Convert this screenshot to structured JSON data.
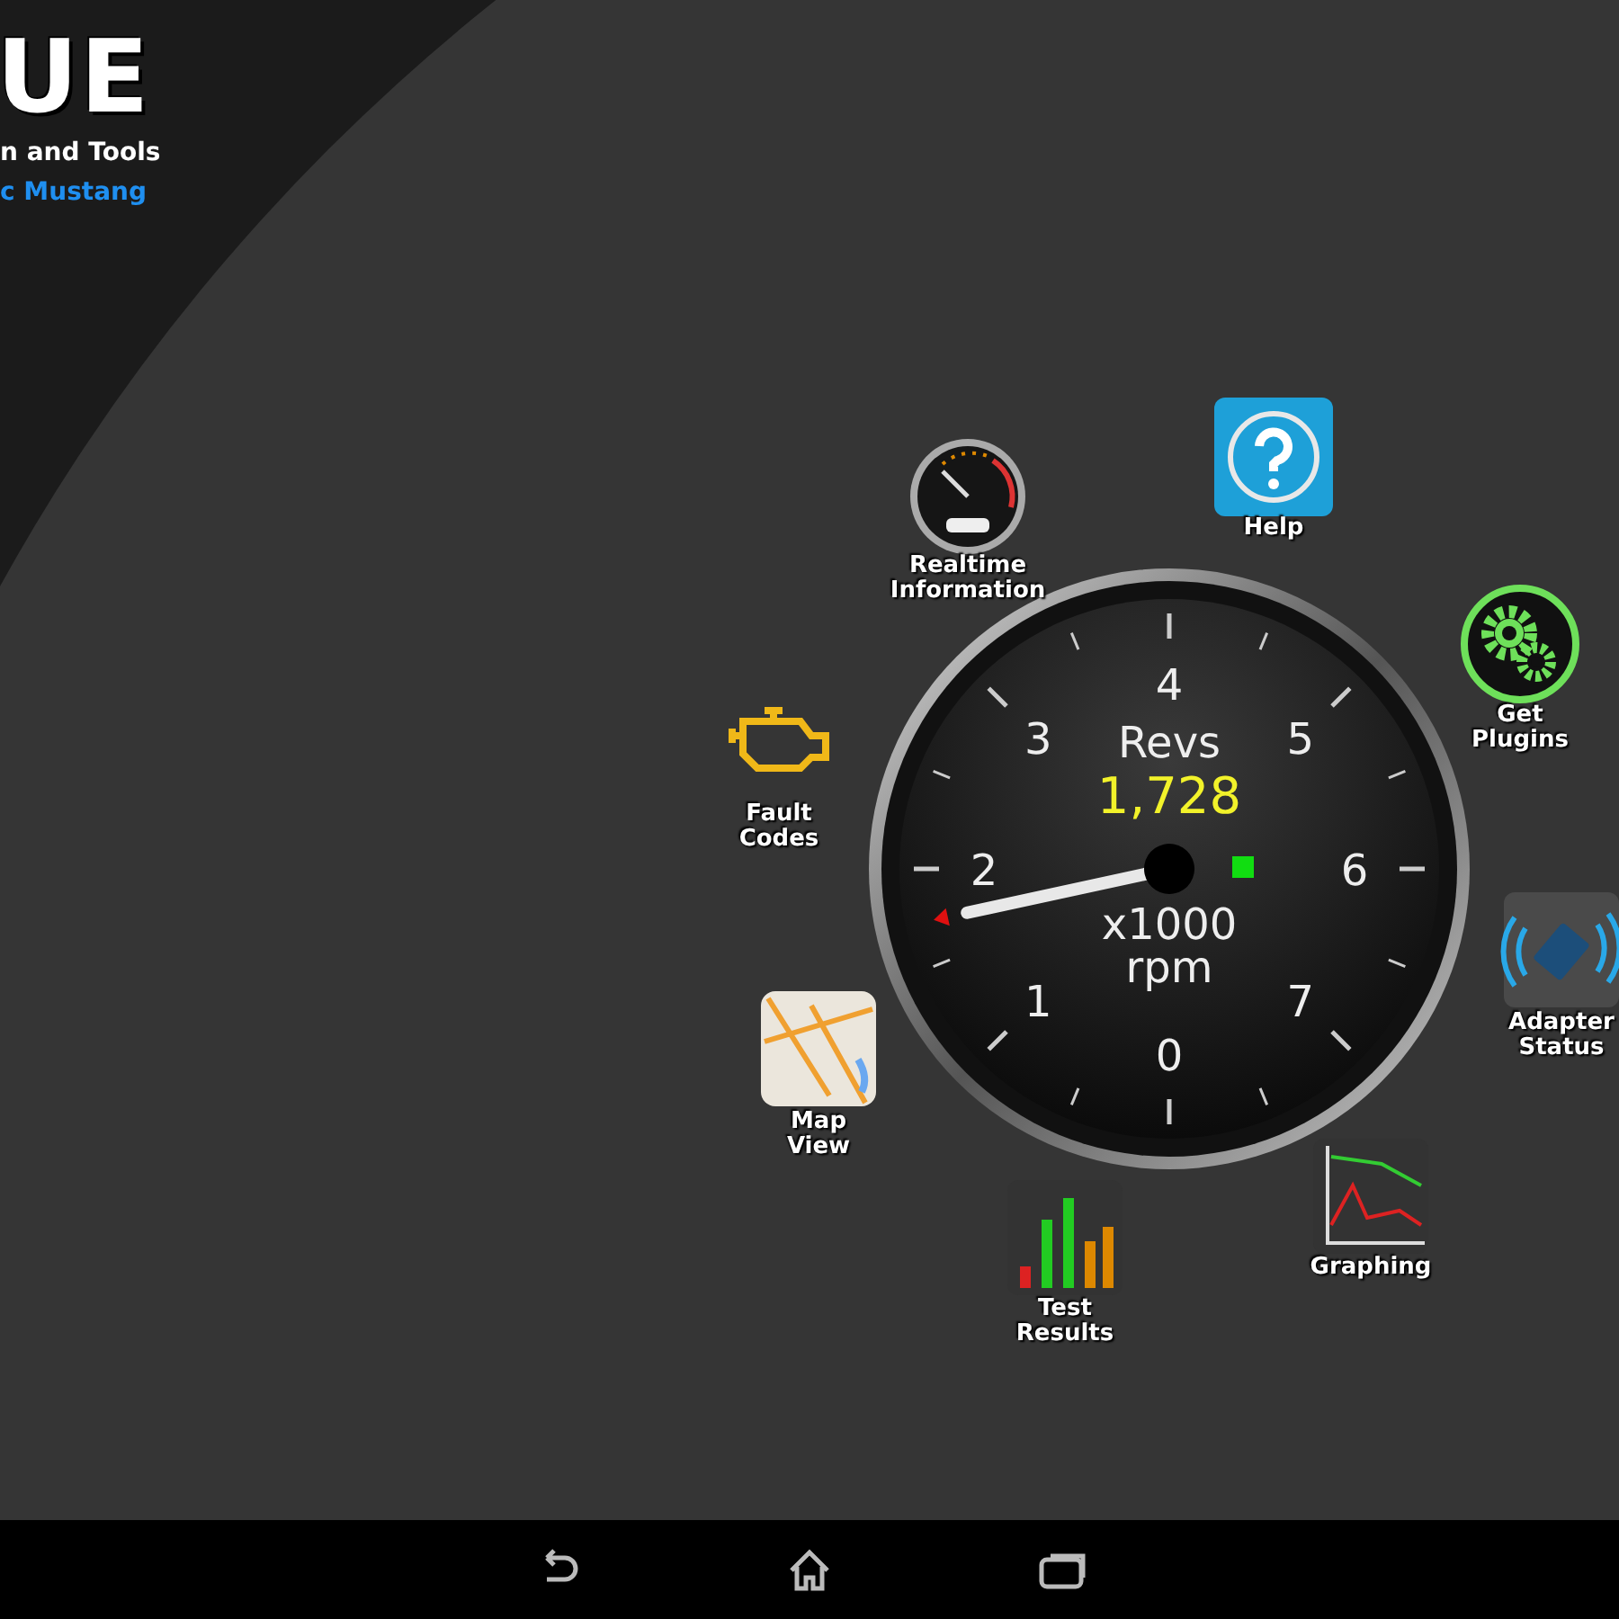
{
  "header": {
    "title": "UE",
    "subtitle": "n and Tools",
    "vehicle": "c Mustang"
  },
  "gauge": {
    "title": "Revs",
    "reading": "1,728",
    "unit_lines": [
      "x1000",
      "rpm"
    ],
    "scale": [
      "0",
      "1",
      "2",
      "3",
      "4",
      "5",
      "6",
      "7"
    ],
    "level": 0.216,
    "indicator_on": true
  },
  "menu": [
    {
      "kind": "speedometer",
      "label_lines": [
        "Realtime",
        "Information"
      ]
    },
    {
      "kind": "help",
      "label_lines": [
        "Help"
      ]
    },
    {
      "kind": "gears",
      "label_lines": [
        "Get",
        "Plugins"
      ]
    },
    {
      "kind": "engine",
      "label_lines": [
        "Fault",
        "Codes"
      ]
    },
    {
      "kind": "adapter",
      "label_lines": [
        "Adapter",
        "Status"
      ]
    },
    {
      "kind": "map",
      "label_lines": [
        "Map",
        "View"
      ]
    },
    {
      "kind": "bars",
      "label_lines": [
        "Test",
        "Results"
      ]
    },
    {
      "kind": "graph",
      "label_lines": [
        "Graphing"
      ]
    }
  ]
}
